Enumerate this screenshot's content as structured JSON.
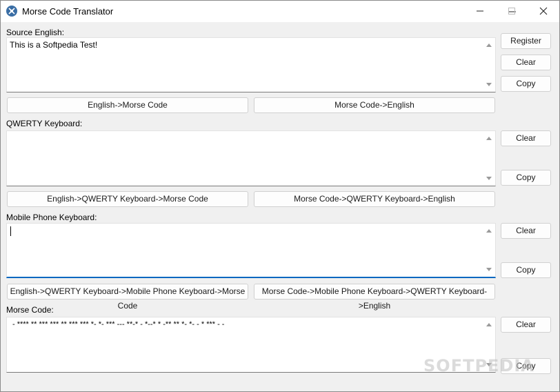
{
  "window": {
    "title": "Morse Code Translator"
  },
  "sections": {
    "source": {
      "label": "Source English:",
      "text": "This is a Softpedia Test!",
      "register_label": "Register",
      "clear_label": "Clear",
      "copy_label": "Copy",
      "to_morse_label": "English->Morse Code",
      "to_english_label": "Morse Code->English"
    },
    "qwerty": {
      "label": "QWERTY Keyboard:",
      "text": "",
      "clear_label": "Clear",
      "copy_label": "Copy",
      "to_morse_label": "English->QWERTY Keyboard->Morse Code",
      "to_english_label": "Morse Code->QWERTY Keyboard->English"
    },
    "mobile": {
      "label": "Mobile Phone Keyboard:",
      "text": "",
      "clear_label": "Clear",
      "copy_label": "Copy",
      "to_morse_label": "English->QWERTY Keyboard->Mobile Phone Keyboard->Morse Code",
      "to_english_label": "Morse Code->Mobile Phone Keyboard->QWERTY Keyboard->English"
    },
    "morse": {
      "label": "Morse Code:",
      "text": "- **** ** *** *** ** *** *** *- *- *** --- **-* - *--* * -** ** *- *- - * *** - -",
      "clear_label": "Clear",
      "copy_label": "Copy"
    }
  },
  "watermark": "SOFTPEDIA",
  "colors": {
    "accent": "#0067c0",
    "window_bg": "#f0f0f0",
    "titlebar_bg": "#ffffff"
  },
  "icons": {
    "app": "morse-app-icon",
    "minimize": "minimize-icon",
    "maximize": "maximize-icon",
    "close": "close-icon",
    "scroll_up": "scroll-up-arrow-icon",
    "scroll_down": "scroll-down-arrow-icon"
  }
}
